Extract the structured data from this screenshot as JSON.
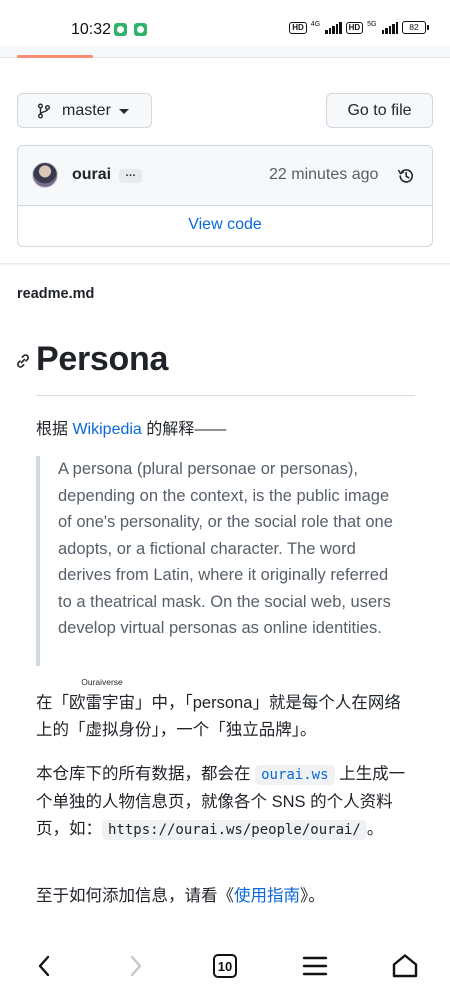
{
  "status_bar": {
    "time": "10:32",
    "network_1": "4G",
    "network_2": "5G",
    "hd_label": "HD",
    "battery": "82"
  },
  "repo": {
    "branch_label": "master",
    "goto_file_label": "Go to file"
  },
  "commit": {
    "author": "ourai",
    "ellipsis": "…",
    "time": "22 minutes ago",
    "view_code_label": "View code"
  },
  "readme": {
    "file_name": "readme.md",
    "heading": "Persona",
    "intro_prefix": "根据 ",
    "intro_link": "Wikipedia",
    "intro_suffix": " 的解释——",
    "blockquote": "A persona (plural personae or personas), depending on the context, is the public image of one's personality, or the social role that one adopts, or a fictional character. The word derives from Latin, where it originally referred to a theatrical mask. On the social web, users develop virtual personas as online identities.",
    "p1_before": "在「",
    "p1_ruby_base": "欧雷宇宙",
    "p1_ruby_text": "Ouraiverse",
    "p1_after": "」中，「persona」就是每个人在网络上的「虚拟身份」，一个「独立品牌」。",
    "p2_before": "本仓库下的所有数据，都会在 ",
    "p2_code_1": "ourai.ws",
    "p2_middle": " 上生成一个单独的人物信息页，就像各个 SNS 的个人资料页，如：",
    "p2_code_2": "https://ourai.ws/people/ourai/",
    "p2_end": "。",
    "p3_before": "至于如何添加信息，请看《",
    "p3_link": "使用指南",
    "p3_after": "》。"
  },
  "bottom_nav": {
    "tab_count": "10",
    "icons": [
      "back-icon",
      "forward-icon",
      "tabs-icon",
      "menu-icon",
      "home-icon"
    ]
  },
  "colors": {
    "link": "#0969da",
    "tab_underline": "#fd8c73",
    "muted_text": "#57606a"
  }
}
